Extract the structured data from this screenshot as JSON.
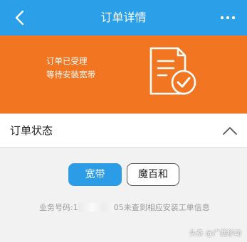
{
  "header": {
    "title": "订单详情",
    "back_icon": "chevron-left-icon",
    "more_icon": "more-dots-icon"
  },
  "banner": {
    "line1": "订单已受理",
    "line2": "等待安装宽带",
    "icon": "document-check-icon"
  },
  "status": {
    "title": "订单状态",
    "toggle_icon": "chevron-up-icon"
  },
  "tabs": [
    {
      "label": "宽带",
      "active": true
    },
    {
      "label": "魔百和",
      "active": false
    }
  ],
  "info": {
    "prefix": "业务号码:1",
    "suffix": "05未查到相应安装工单信息"
  },
  "watermark": {
    "text": "头条 @广西移动"
  },
  "colors": {
    "header": "#2ba0e8",
    "banner": "#f27621",
    "active_tab": "#2c9ce6"
  }
}
